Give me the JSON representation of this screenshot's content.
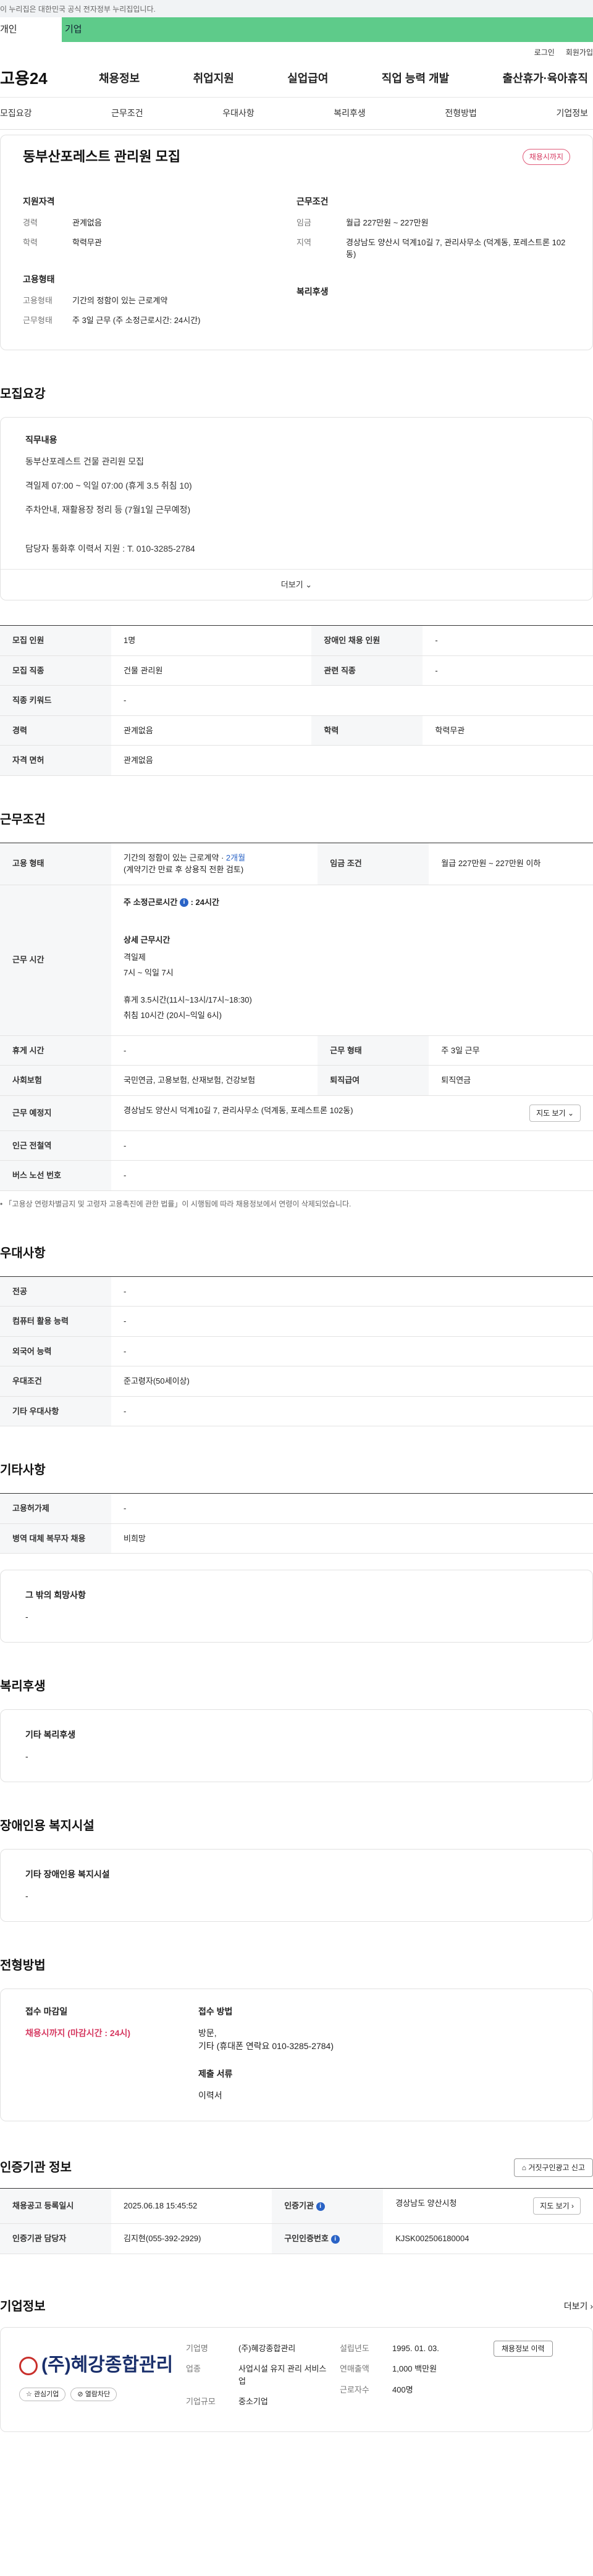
{
  "gov_banner": "이 누리집은 대한민국 공식 전자정부 누리집입니다.",
  "tabs": {
    "person": "개인",
    "company": "기업"
  },
  "util": {
    "login": "로그인",
    "signup": "회원가입"
  },
  "logo": "고용24",
  "gnb": [
    "채용정보",
    "취업지원",
    "실업급여",
    "직업 능력 개발",
    "출산휴가·육아휴직"
  ],
  "anchors": [
    "모집요강",
    "근무조건",
    "우대사항",
    "복리후생",
    "전형방법",
    "기업정보"
  ],
  "summary": {
    "title": "동부산포레스트 관리원 모집",
    "status": "채용시까지",
    "qual_title": "지원자격",
    "career_label": "경력",
    "career_value": "관계없음",
    "edu_label": "학력",
    "edu_value": "학력무관",
    "cond_title": "근무조건",
    "wage_label": "임금",
    "wage_value": "월급 227만원 ~ 227만원",
    "region_label": "지역",
    "region_value": "경상남도 양산시 덕계10길 7, 관리사무소 (덕계동, 포레스트론 102동)",
    "emp_title": "고용형태",
    "emp_type_label": "고용형태",
    "emp_type_value": "기간의 정함이 있는 근로계약",
    "work_type_label": "근무형태",
    "work_type_value": "주 3일 근무 (주 소정근로시간: 24시간)",
    "welfare_title": "복리후생"
  },
  "recruit": {
    "section_title": "모집요강",
    "duty_title": "직무내용",
    "lines": [
      "동부산포레스트 건물 관리원 모집",
      "격일제  07:00 ~ 익일 07:00 (휴게 3.5   취침 10)",
      "주차안내,    재활용장 정리 등 (7월1일 근무예정)",
      "담당자 통화후 이력서 지원 :  T. 010-3285-2784"
    ],
    "more": "더보기"
  },
  "recruit_table": [
    {
      "k1": "모집 인원",
      "v1": "1명",
      "k2": "장애인 채용 인원",
      "v2": "-"
    },
    {
      "k1": "모집 직종",
      "v1": "건물 관리원",
      "k2": "관련 직종",
      "v2": "-"
    },
    {
      "k1": "직종 키워드",
      "v1": "-"
    },
    {
      "k1": "경력",
      "v1": "관계없음",
      "k2": "학력",
      "v2": "학력무관"
    },
    {
      "k1": "자격 면허",
      "v1": "관계없음"
    }
  ],
  "conditions": {
    "section_title": "근무조건",
    "emp_label": "고용 형태",
    "emp_value_a": "기간의 정함이 있는 근로계약 · ",
    "emp_value_link": "2개월",
    "emp_value_b": "(계약기간 만료 후 상용직 전환 검토)",
    "wage_label": "임금 조건",
    "wage_value": "월급 227만원 ~ 227만원 이하",
    "time_label": "근무 시간",
    "time_head": "주 소정근로시간",
    "time_head_value": ": 24시간",
    "detail_title": "상세 근무시간",
    "detail_lines": [
      "격일제",
      "7시   ~ 익일 7시",
      "휴게 3.5시간(11시~13시/17시~18:30)",
      "취침  10시간 (20시~익일 6시)"
    ],
    "rest_label": "휴게 시간",
    "rest_value": "-",
    "worktype_label": "근무 형태",
    "worktype_value": "주 3일 근무",
    "insurance_label": "사회보험",
    "insurance_value": "국민연금, 고용보험, 산재보험, 건강보험",
    "severance_label": "퇴직급여",
    "severance_value": "퇴직연금",
    "place_label": "근무 예정지",
    "place_value": "경상남도 양산시 덕계10길 7, 관리사무소 (덕계동, 포레스트론 102동)",
    "map_button": "지도 보기",
    "subway_label": "인근 전철역",
    "subway_value": "-",
    "bus_label": "버스 노선 번호",
    "bus_value": "-",
    "note": "「고용상 연령차별금지 및 고령자 고용촉진에 관한 법률」이 시행됨에 따라 채용정보에서 연령이 삭제되었습니다."
  },
  "preferred": {
    "section_title": "우대사항",
    "rows": [
      {
        "k": "전공",
        "v": "-"
      },
      {
        "k": "컴퓨터 활용 능력",
        "v": "-"
      },
      {
        "k": "외국어 능력",
        "v": "-"
      },
      {
        "k": "우대조건",
        "v": "준고령자(50세이상)"
      },
      {
        "k": "기타 우대사항",
        "v": "-"
      }
    ]
  },
  "other": {
    "section_title": "기타사항",
    "rows": [
      {
        "k": "고용허가제",
        "v": "-"
      },
      {
        "k": "병역 대체 복무자 채용",
        "v": "비희망"
      }
    ],
    "extra_title": "그 밖의 희망사항",
    "extra_value": "-"
  },
  "welfare": {
    "section_title": "복리후생",
    "sub": "기타 복리후생",
    "value": "-"
  },
  "disability": {
    "section_title": "장애인용 복지시설",
    "sub": "기타 장애인용 복지시설",
    "value": "-"
  },
  "method": {
    "section_title": "전형방법",
    "deadline_title": "접수 마감일",
    "deadline_value": "채용시까지 (마감시간 : 24시)",
    "receive_title": "접수 방법",
    "receive_lines": [
      "방문,",
      "기타 (휴대폰 연락요 010-3285-2784)"
    ],
    "docs_title": "제출 서류",
    "docs_value": "이력서"
  },
  "cert": {
    "section_title": "인증기관 정보",
    "report_button": "거짓구인광고 신고",
    "reg_label": "채용공고 등록일시",
    "reg_value": "2025.06.18 15:45:52",
    "org_label": "인증기관",
    "org_value": "경상남도 양산시청",
    "map_button": "지도 보기",
    "mgr_label": "인증기관 담당자",
    "mgr_value": "김지현(055-392-2929)",
    "no_label": "구인인증번호",
    "no_value": "KJSK002506180004"
  },
  "company": {
    "section_title": "기업정보",
    "more": "더보기",
    "name_logo": "(주)혜강종합관리",
    "btn_interest": "관심기업",
    "btn_hidden": "열람차단",
    "name_label": "기업명",
    "name_value": "(주)혜강종합관리",
    "industry_label": "업종",
    "industry_value": "사업시설 유지 관리 서비스업",
    "size_label": "기업규모",
    "size_value": "중소기업",
    "founded_label": "설립년도",
    "founded_value": "1995. 01. 03.",
    "revenue_label": "연매출액",
    "revenue_value": "1,000 백만원",
    "staff_label": "근로자수",
    "staff_value": "400명",
    "history_button": "채용정보 이력"
  }
}
